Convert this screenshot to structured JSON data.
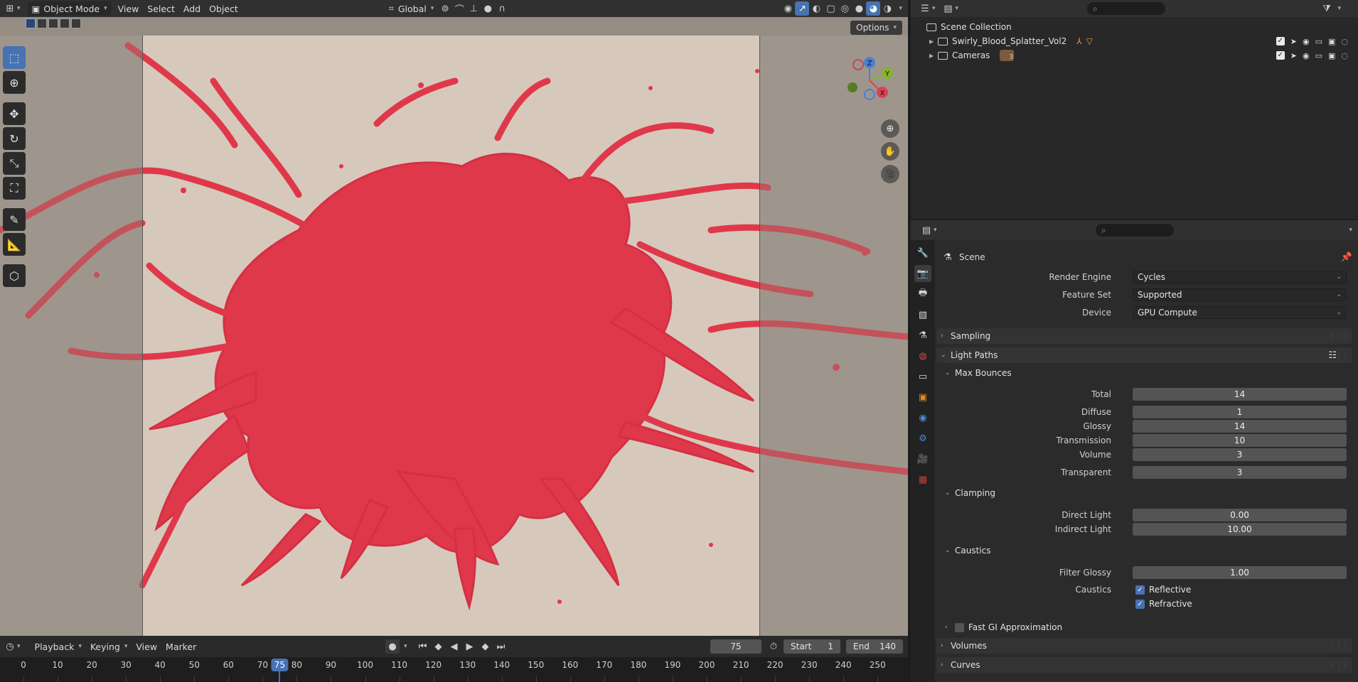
{
  "header": {
    "mode_label": "Object Mode",
    "menu": [
      "View",
      "Select",
      "Add",
      "Object"
    ],
    "transform_orientation": "Global"
  },
  "viewport": {
    "options_label": "Options",
    "gizmo_axes": {
      "x": "X",
      "y": "Y",
      "z": "Z"
    },
    "colors": {
      "background": "#aaa299",
      "plane": "#d6c9bb",
      "splatter": "#e0384b",
      "axis_x": "#e04050",
      "axis_y": "#86b32c",
      "axis_z": "#4a7fd6"
    }
  },
  "timeline": {
    "menu": [
      "Playback",
      "Keying",
      "View",
      "Marker"
    ],
    "current_frame": "75",
    "start_label": "Start",
    "start_value": "1",
    "end_label": "End",
    "end_value": "140",
    "ruler_labels": [
      "0",
      "10",
      "20",
      "30",
      "40",
      "50",
      "60",
      "70",
      "80",
      "90",
      "100",
      "110",
      "120",
      "130",
      "140",
      "150",
      "160",
      "170",
      "180",
      "190",
      "200",
      "210",
      "220",
      "230",
      "240",
      "250"
    ]
  },
  "outliner": {
    "root": "Scene Collection",
    "items": [
      {
        "name": "Swirly_Blood_Splatter_Vol2"
      },
      {
        "name": "Cameras",
        "badge": "3"
      }
    ]
  },
  "properties": {
    "context": "Scene",
    "render_engine_label": "Render Engine",
    "render_engine": "Cycles",
    "feature_set_label": "Feature Set",
    "feature_set": "Supported",
    "device_label": "Device",
    "device": "GPU Compute",
    "sampling": "Sampling",
    "light_paths": "Light Paths",
    "max_bounces": "Max Bounces",
    "bounces": [
      {
        "label": "Total",
        "value": "14"
      },
      {
        "label": "Diffuse",
        "value": "1"
      },
      {
        "label": "Glossy",
        "value": "14"
      },
      {
        "label": "Transmission",
        "value": "10"
      },
      {
        "label": "Volume",
        "value": "3"
      },
      {
        "label": "Transparent",
        "value": "3"
      }
    ],
    "clamping": "Clamping",
    "direct_light_label": "Direct Light",
    "direct_light": "0.00",
    "indirect_light_label": "Indirect Light",
    "indirect_light": "10.00",
    "caustics": "Caustics",
    "filter_glossy_label": "Filter Glossy",
    "filter_glossy": "1.00",
    "caustics_label": "Caustics",
    "reflective": "Reflective",
    "refractive": "Refractive",
    "fast_gi": "Fast GI Approximation",
    "volumes": "Volumes",
    "curves": "Curves"
  }
}
